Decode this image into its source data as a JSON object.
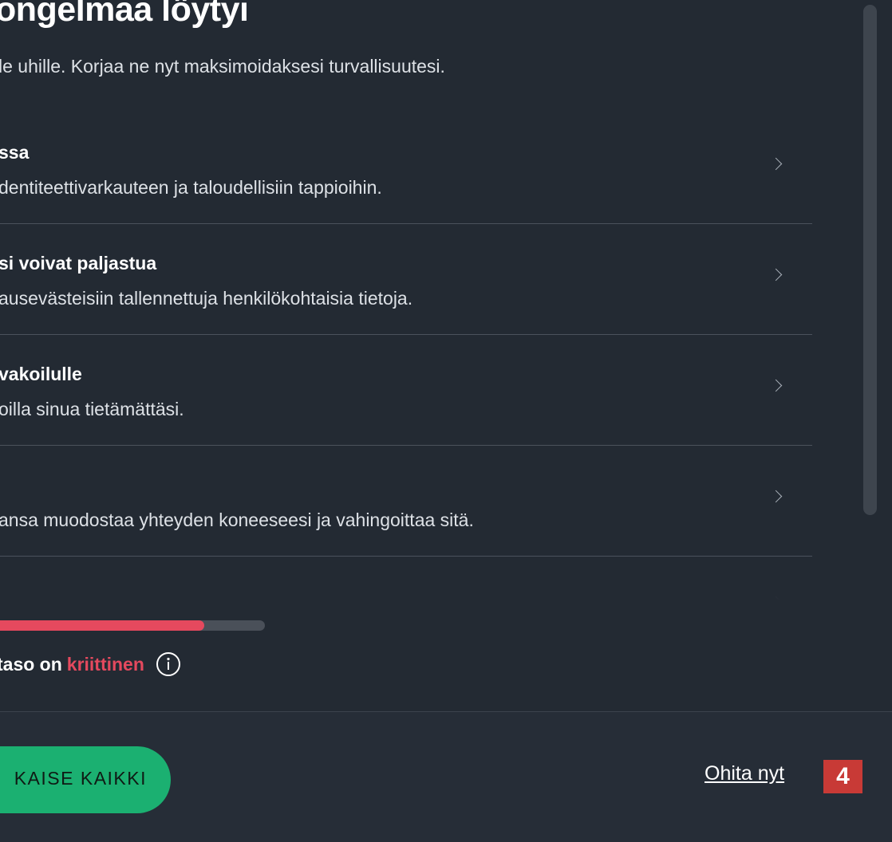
{
  "header": {
    "title": "ongelmaa löytyi",
    "subtitle": "le uhille. Korjaa ne nyt maksimoidaksesi turvallisuutesi."
  },
  "issues": [
    {
      "title": "ssa",
      "description": "dentiteettivarkauteen ja taloudellisiin tappioihin."
    },
    {
      "title": "si voivat paljastua",
      "description": "ausevästeisiin tallennettuja henkilökohtaisia tietoja."
    },
    {
      "title": "vakoilulle",
      "description": "oilla sinua tietämättäsi."
    },
    {
      "title": "",
      "description": "ansa muodostaa yhteyden koneeseesi ja vahingoittaa sitä."
    }
  ],
  "risk": {
    "label": "taso on",
    "level": "kriittinen",
    "level_color": "#e5495e",
    "progress_fraction": 0.77
  },
  "footer": {
    "primary_button_label": "KAISE KAIKKI",
    "skip_link_label": "Ohita nyt",
    "step_badge": "4"
  },
  "colors": {
    "background": "#232a33",
    "accent_green": "#1bb071",
    "critical_red": "#e5495e",
    "badge_red": "#c83a36"
  },
  "icons": {
    "row_action": "chevron-right-icon",
    "risk_info": "info-icon"
  }
}
